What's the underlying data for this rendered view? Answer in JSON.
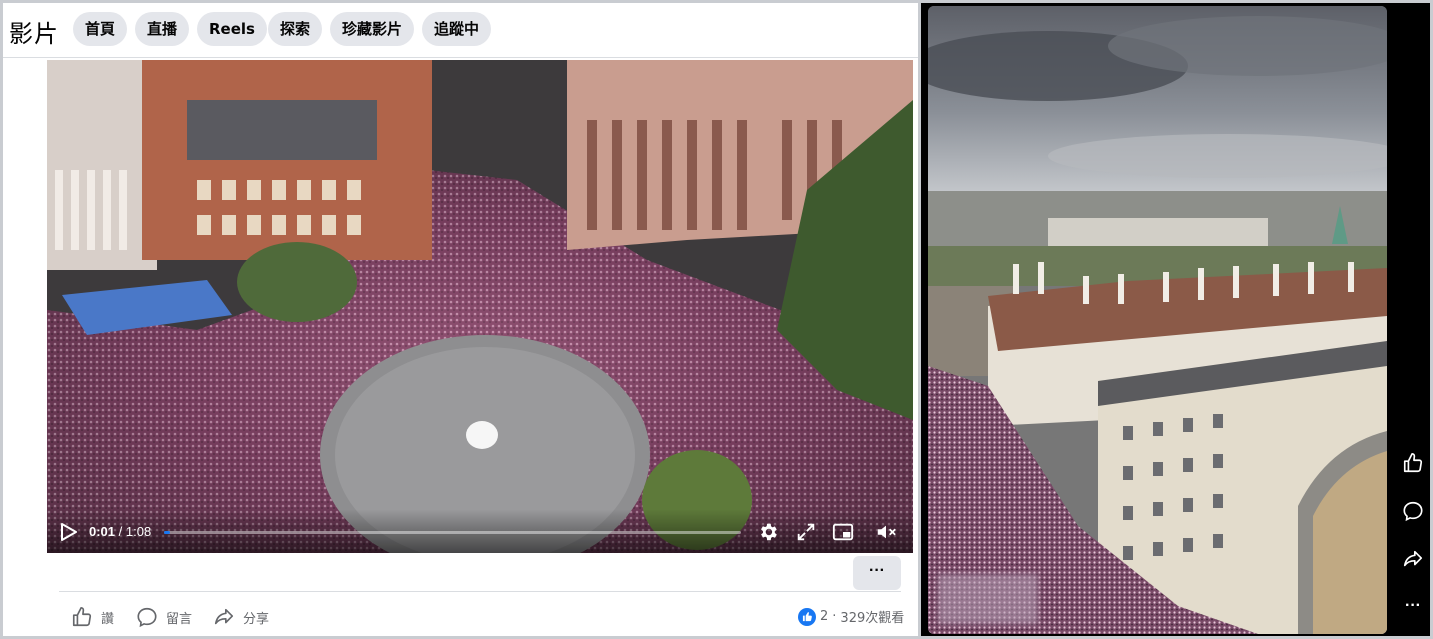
{
  "header": {
    "title": "影片",
    "tabs": [
      {
        "label": "首頁"
      },
      {
        "label": "直播"
      },
      {
        "label": "Reels"
      },
      {
        "label": "探索"
      },
      {
        "label": "珍藏影片"
      },
      {
        "label": "追蹤中"
      }
    ]
  },
  "player": {
    "current_time": "0:01",
    "separator": " / ",
    "duration": "1:08",
    "progress_fraction": 0.01
  },
  "post": {
    "more_label": "···",
    "actions": {
      "like_label": "讚",
      "comment_label": "留言",
      "share_label": "分享"
    },
    "reaction_count": "2",
    "stats_separator": "·",
    "views_label": "329次觀看"
  },
  "reel": {
    "more_label": "···"
  },
  "colors": {
    "accent": "#1877f2",
    "pill_bg": "#e4e6eb",
    "meta_text": "#65676b"
  },
  "icons": [
    "play-icon",
    "settings-icon",
    "fullscreen-icon",
    "pip-icon",
    "mute-icon",
    "like-icon",
    "comment-icon",
    "share-icon"
  ]
}
